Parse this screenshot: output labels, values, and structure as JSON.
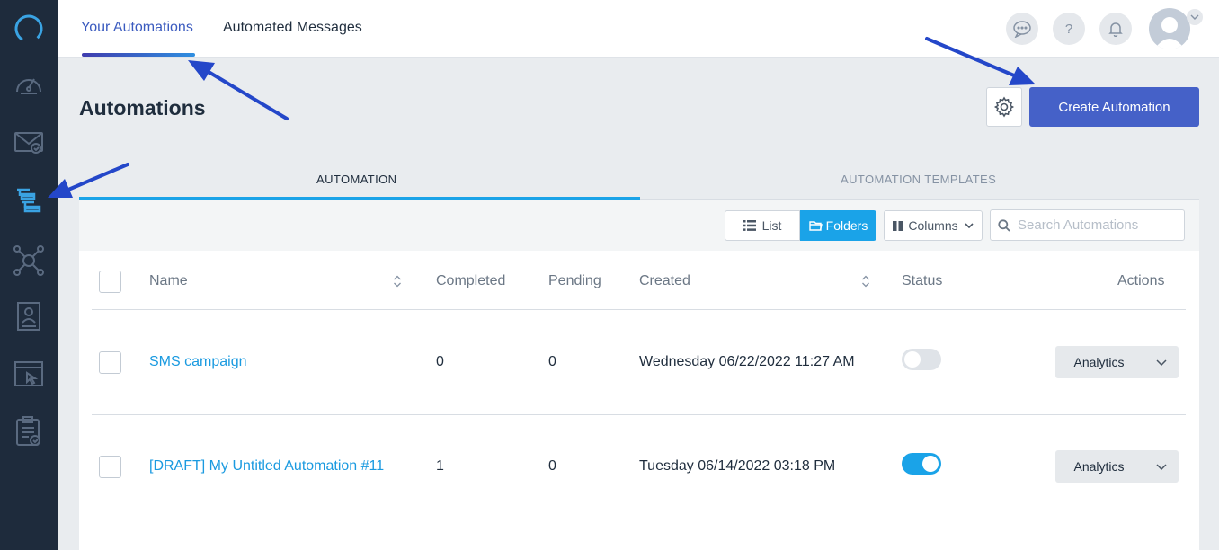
{
  "topbar": {
    "tabs": [
      {
        "label": "Your Automations",
        "active": true
      },
      {
        "label": "Automated Messages",
        "active": false
      }
    ],
    "icons": [
      "chat-icon",
      "help-icon",
      "bell-icon",
      "avatar",
      "chevron-down-icon"
    ],
    "help_glyph": "?"
  },
  "sidebar": {
    "items": [
      "logo-icon",
      "dashboard-icon",
      "campaigns-icon",
      "automations-icon",
      "contacts-network-icon",
      "forms-icon",
      "landing-page-icon",
      "reports-icon"
    ]
  },
  "header": {
    "title": "Automations",
    "create_label": "Create Automation"
  },
  "section_tabs": [
    {
      "label": "AUTOMATION",
      "active": true
    },
    {
      "label": "AUTOMATION TEMPLATES",
      "active": false
    }
  ],
  "toolbar": {
    "list_label": "List",
    "folders_label": "Folders",
    "columns_label": "Columns",
    "search_placeholder": "Search Automations"
  },
  "table": {
    "columns": [
      "Name",
      "Completed",
      "Pending",
      "Created",
      "Status",
      "Actions"
    ],
    "rows": [
      {
        "name": "SMS campaign",
        "completed": "0",
        "pending": "0",
        "created": "Wednesday 06/22/2022 11:27 AM",
        "status_on": false,
        "action": "Analytics"
      },
      {
        "name": "[DRAFT] My Untitled Automation #11",
        "completed": "1",
        "pending": "0",
        "created": "Tuesday 06/14/2022 03:18 PM",
        "status_on": true,
        "action": "Analytics"
      }
    ]
  },
  "colors": {
    "sidebar_bg": "#1e2b3c",
    "primary": "#4561c8",
    "accent": "#1aa3e8",
    "link": "#1a9ae0",
    "annotation_arrow": "#2447c9"
  }
}
